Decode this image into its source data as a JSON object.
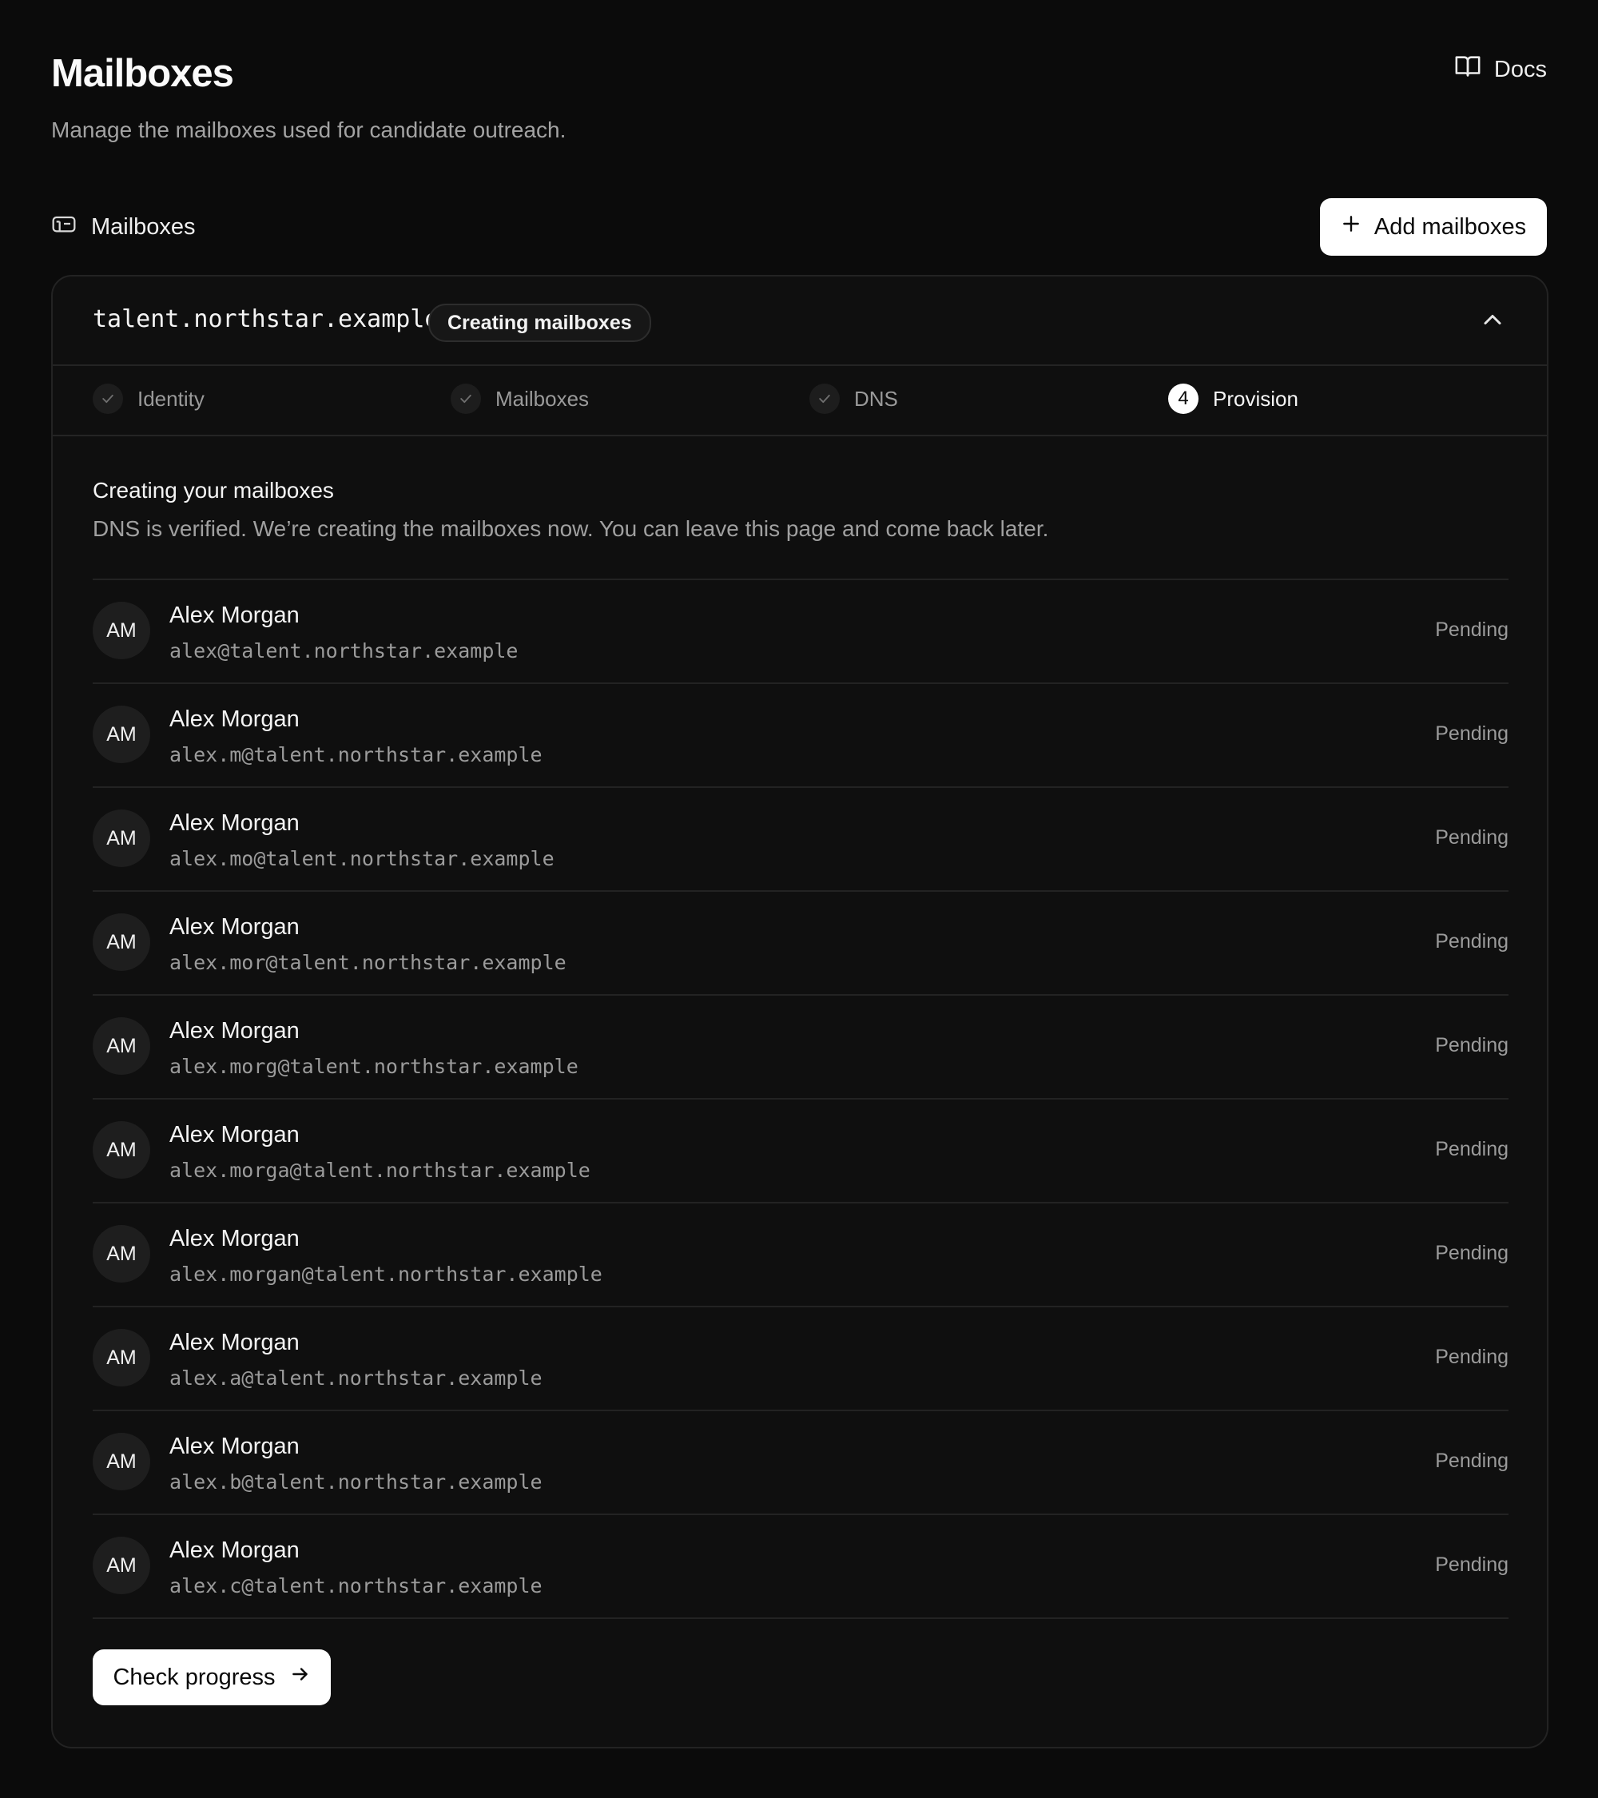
{
  "header": {
    "title": "Mailboxes",
    "subtitle": "Manage the mailboxes used for candidate outreach.",
    "docs_label": "Docs"
  },
  "section": {
    "label": "Mailboxes",
    "add_button": "Add mailboxes"
  },
  "card": {
    "domain": "talent.northstar.example",
    "badge": "Creating mailboxes",
    "steps": [
      {
        "label": "Identity",
        "state": "done"
      },
      {
        "label": "Mailboxes",
        "state": "done"
      },
      {
        "label": "DNS",
        "state": "done"
      },
      {
        "label": "Provision",
        "state": "active",
        "number": "4"
      }
    ],
    "body_title": "Creating your mailboxes",
    "body_desc": "DNS is verified. We’re creating the mailboxes now. You can leave this page and come back later.",
    "mailboxes": [
      {
        "initials": "AM",
        "name": "Alex Morgan",
        "email": "alex@talent.northstar.example",
        "status": "Pending"
      },
      {
        "initials": "AM",
        "name": "Alex Morgan",
        "email": "alex.m@talent.northstar.example",
        "status": "Pending"
      },
      {
        "initials": "AM",
        "name": "Alex Morgan",
        "email": "alex.mo@talent.northstar.example",
        "status": "Pending"
      },
      {
        "initials": "AM",
        "name": "Alex Morgan",
        "email": "alex.mor@talent.northstar.example",
        "status": "Pending"
      },
      {
        "initials": "AM",
        "name": "Alex Morgan",
        "email": "alex.morg@talent.northstar.example",
        "status": "Pending"
      },
      {
        "initials": "AM",
        "name": "Alex Morgan",
        "email": "alex.morga@talent.northstar.example",
        "status": "Pending"
      },
      {
        "initials": "AM",
        "name": "Alex Morgan",
        "email": "alex.morgan@talent.northstar.example",
        "status": "Pending"
      },
      {
        "initials": "AM",
        "name": "Alex Morgan",
        "email": "alex.a@talent.northstar.example",
        "status": "Pending"
      },
      {
        "initials": "AM",
        "name": "Alex Morgan",
        "email": "alex.b@talent.northstar.example",
        "status": "Pending"
      },
      {
        "initials": "AM",
        "name": "Alex Morgan",
        "email": "alex.c@talent.northstar.example",
        "status": "Pending"
      }
    ],
    "check_button": "Check progress"
  },
  "icons": {
    "docs": "book-open-icon",
    "section": "mailbox-icon",
    "add": "plus-icon",
    "collapse": "chevron-up-icon",
    "step_done": "check-icon",
    "check": "arrow-right-icon"
  }
}
